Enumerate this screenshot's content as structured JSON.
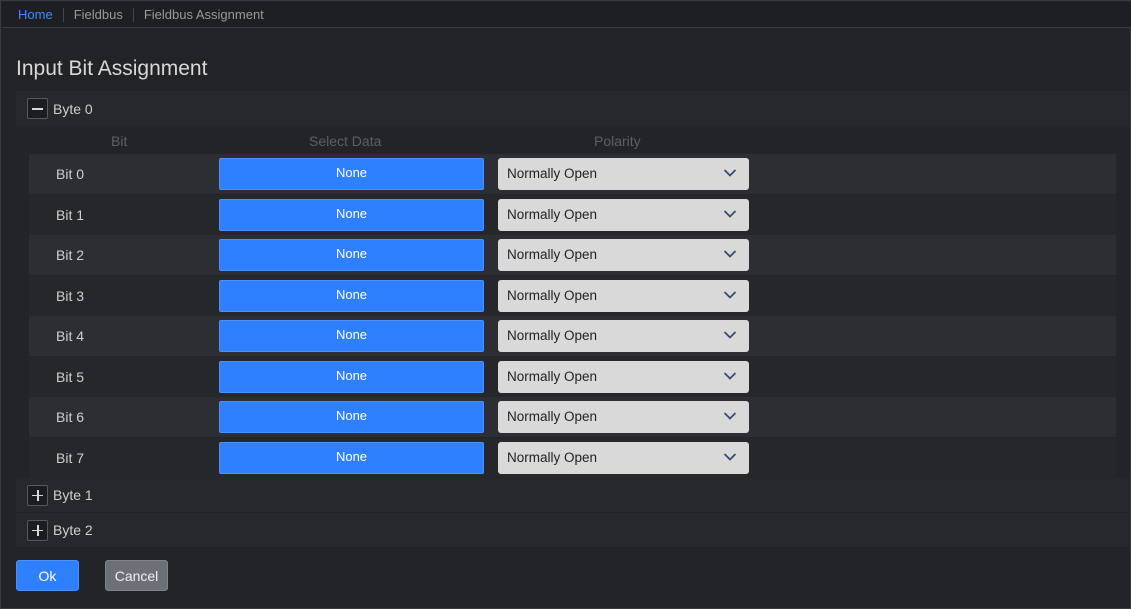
{
  "breadcrumb": [
    "Home",
    "Fieldbus",
    "Fieldbus Assignment"
  ],
  "page_title": "Input Bit Assignment",
  "columns": {
    "bit": "Bit",
    "select_data": "Select Data",
    "polarity": "Polarity"
  },
  "bytes": [
    {
      "label": "Byte 0",
      "expanded": true
    },
    {
      "label": "Byte 1",
      "expanded": false
    },
    {
      "label": "Byte 2",
      "expanded": false
    }
  ],
  "rows": [
    {
      "bit": "Bit 0",
      "select": "None",
      "polarity": "Normally Open"
    },
    {
      "bit": "Bit 1",
      "select": "None",
      "polarity": "Normally Open"
    },
    {
      "bit": "Bit 2",
      "select": "None",
      "polarity": "Normally Open"
    },
    {
      "bit": "Bit 3",
      "select": "None",
      "polarity": "Normally Open"
    },
    {
      "bit": "Bit 4",
      "select": "None",
      "polarity": "Normally Open"
    },
    {
      "bit": "Bit 5",
      "select": "None",
      "polarity": "Normally Open"
    },
    {
      "bit": "Bit 6",
      "select": "None",
      "polarity": "Normally Open"
    },
    {
      "bit": "Bit 7",
      "select": "None",
      "polarity": "Normally Open"
    }
  ],
  "buttons": {
    "ok": "Ok",
    "cancel": "Cancel"
  },
  "icons": {
    "collapse": "minus-icon",
    "expand": "plus-icon",
    "dropdown": "chevron-down-icon"
  },
  "colors": {
    "accent": "#2f80ff",
    "background": "#222326"
  }
}
